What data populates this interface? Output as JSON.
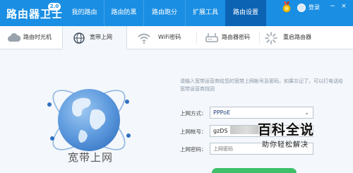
{
  "app": {
    "title": "路由器卫士",
    "version": "2.0",
    "login_label": "登录",
    "window_controls": [
      "−",
      "×"
    ]
  },
  "nav": {
    "tabs": [
      {
        "label": "我的路由",
        "active": false
      },
      {
        "label": "路由防黑",
        "active": false
      },
      {
        "label": "路由跑分",
        "active": false
      },
      {
        "label": "扩展工具",
        "active": false
      },
      {
        "label": "路由设置",
        "active": true
      }
    ]
  },
  "subnav": {
    "items": [
      {
        "label": "路由时光机",
        "icon": "cloud-icon",
        "active": false
      },
      {
        "label": "宽带上网",
        "icon": "globe-icon",
        "active": true
      },
      {
        "label": "WiFi密码",
        "icon": "wifi-icon",
        "active": false
      },
      {
        "label": "路由器密码",
        "icon": "router-icon",
        "active": false
      },
      {
        "label": "重启路由器",
        "icon": "restart-icon",
        "active": false
      }
    ]
  },
  "main": {
    "globe_label": "宽带上网",
    "instructions": "请输入宽带运营商给您的宽带上网帐号及密码，如果忘记了，可以打电话给宽带运营商找回",
    "form": {
      "mode_label": "上网方式：",
      "mode_value": "PPPoE",
      "account_label": "上网帐号：",
      "account_value": "gzDS",
      "password_label": "上网密码：",
      "password_placeholder": "上网密码"
    }
  },
  "watermark": {
    "title": "百科全说",
    "subtitle": "助你轻松解决"
  },
  "colors": {
    "brand_blue": "#1a8ee3",
    "active_tab": "#0c63b4",
    "globe_blue": "#5f9bde",
    "action_green": "#3ec06a"
  }
}
